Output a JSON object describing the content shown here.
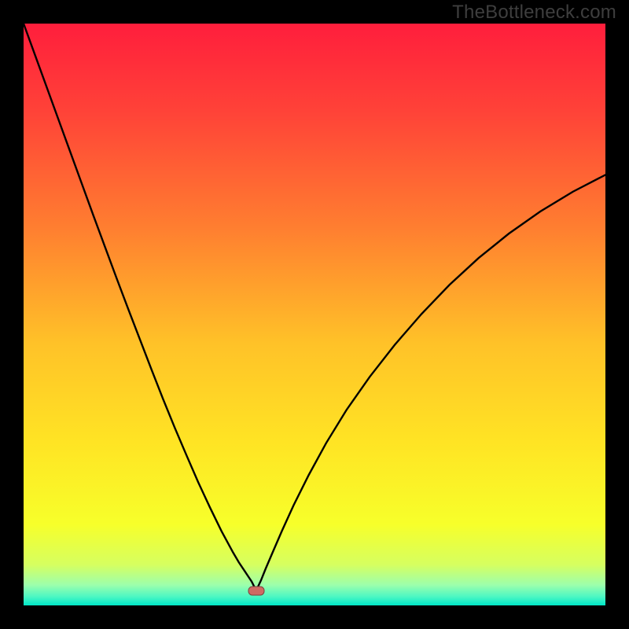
{
  "watermark": "TheBottleneck.com",
  "colors": {
    "frame": "#000000",
    "watermark_text": "#3e3e3e",
    "curve": "#000000",
    "marker_fill": "#cf6a63",
    "marker_stroke": "#7d433f",
    "gradient_stops": [
      {
        "offset": 0.0,
        "color": "#ff1e3c"
      },
      {
        "offset": 0.15,
        "color": "#ff4238"
      },
      {
        "offset": 0.35,
        "color": "#ff7e30"
      },
      {
        "offset": 0.55,
        "color": "#ffc228"
      },
      {
        "offset": 0.72,
        "color": "#ffe424"
      },
      {
        "offset": 0.86,
        "color": "#f7ff2a"
      },
      {
        "offset": 0.93,
        "color": "#d6ff60"
      },
      {
        "offset": 0.965,
        "color": "#9cffac"
      },
      {
        "offset": 0.985,
        "color": "#4cf7c3"
      },
      {
        "offset": 1.0,
        "color": "#00e7c7"
      }
    ]
  },
  "chart_data": {
    "type": "line",
    "title": "",
    "xlabel": "",
    "ylabel": "",
    "xlim": [
      0,
      100
    ],
    "ylim": [
      0,
      100
    ],
    "marker": {
      "x": 40,
      "y": 2.5
    },
    "series": [
      {
        "name": "left-branch",
        "x": [
          0,
          2,
          4,
          6,
          8,
          10,
          12,
          14,
          16,
          18,
          20,
          22,
          24,
          26,
          28,
          30,
          32,
          34,
          36,
          37,
          38,
          38.6,
          39.2,
          39.6,
          40
        ],
        "values": [
          100,
          94.5,
          89,
          83.5,
          78,
          72.5,
          67,
          61.6,
          56.2,
          50.9,
          45.7,
          40.5,
          35.4,
          30.5,
          25.8,
          21.2,
          16.9,
          12.8,
          9.1,
          7.4,
          5.9,
          5.0,
          4.1,
          3.3,
          2.6
        ]
      },
      {
        "name": "right-branch",
        "x": [
          40,
          40.8,
          41.6,
          42.8,
          44.4,
          46.4,
          49,
          52,
          55.5,
          59.5,
          63.8,
          68.4,
          73.2,
          78.2,
          83.4,
          88.8,
          94.4,
          100
        ],
        "values": [
          2.6,
          4.3,
          6.3,
          9.1,
          12.8,
          17.2,
          22.4,
          27.9,
          33.6,
          39.3,
          44.8,
          50.1,
          55.1,
          59.7,
          63.9,
          67.7,
          71.1,
          74.0
        ]
      }
    ]
  }
}
